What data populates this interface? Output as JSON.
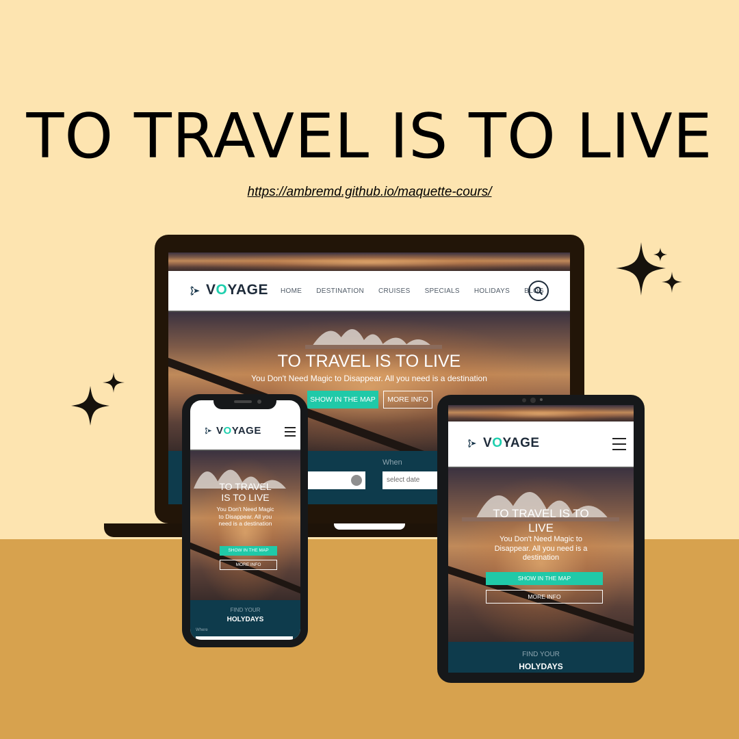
{
  "headline": "TO TRAVEL IS TO LIVE",
  "url": "https://ambremd.github.io/maquette-cours/",
  "colors": {
    "background_top": "#fde4b0",
    "background_bottom": "#d7a24e",
    "accent": "#20c9a8",
    "dark_teal": "#0e3b4c"
  },
  "site": {
    "logo_prefix": "V",
    "logo_o": "O",
    "logo_suffix": "YAGE",
    "nav": [
      "HOME",
      "DESTINATION",
      "CRUISES",
      "SPECIALS",
      "HOLIDAYS",
      "BLOG"
    ],
    "hero_title": "TO TRAVEL IS TO LIVE",
    "hero_subtitle": "You Don't Need Magic to Disappear. All you need is a destination",
    "btn_map": "SHOW IN THE MAP",
    "btn_info": "MORE INFO",
    "when_label": "When",
    "date_placeholder": "select date",
    "find_label": "FIND YOUR",
    "holydays_label": "HOLYDAYS",
    "where_label": "Where",
    "phone_title_1": "TO TRAVEL",
    "phone_title_2": "IS TO LIVE",
    "tablet_title_1": "TO TRAVEL IS TO",
    "tablet_title_2": "LIVE"
  },
  "icons": [
    "plane-icon",
    "search-icon",
    "globe-icon",
    "hamburger-icon",
    "sparkle-icon"
  ]
}
